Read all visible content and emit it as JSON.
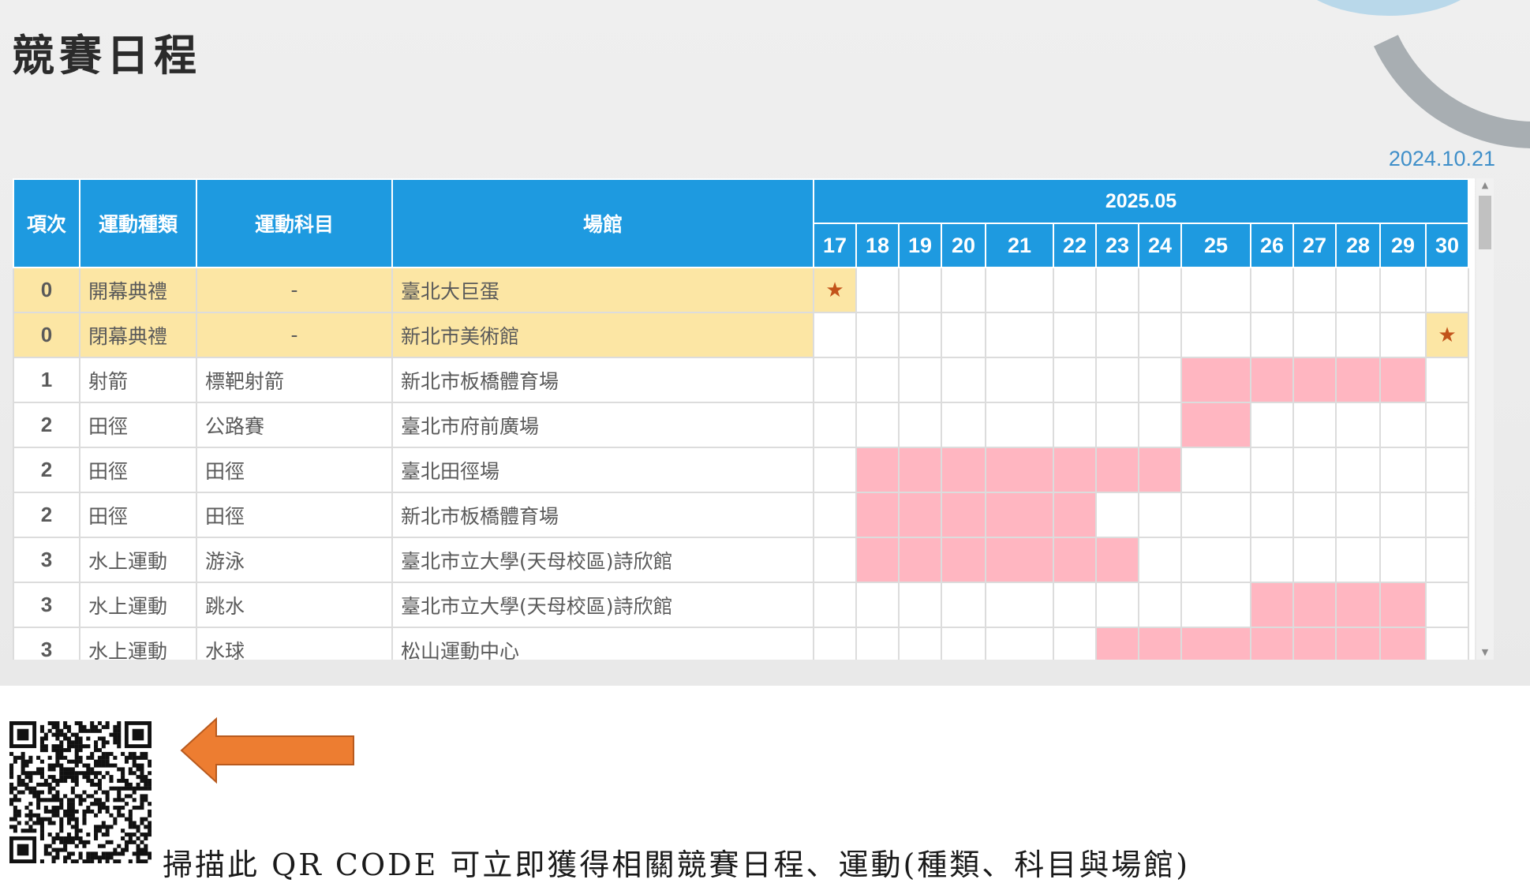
{
  "page_title": "競賽日程",
  "update_date": "2024.10.21",
  "table": {
    "headers": {
      "index": "項次",
      "sport": "運動種類",
      "event": "運動科目",
      "venue": "場館",
      "month": "2025.05"
    },
    "days": [
      "17",
      "18",
      "19",
      "20",
      "21",
      "22",
      "23",
      "24",
      "25",
      "26",
      "27",
      "28",
      "29",
      "30"
    ],
    "marker_symbol": "★",
    "rows": [
      {
        "index": "0",
        "sport": "開幕典禮",
        "event": "-",
        "venue": "臺北大巨蛋",
        "ceremony": true,
        "active_days": [],
        "star_days": [
          "17"
        ]
      },
      {
        "index": "0",
        "sport": "閉幕典禮",
        "event": "-",
        "venue": "新北市美術館",
        "ceremony": true,
        "active_days": [],
        "star_days": [
          "30"
        ]
      },
      {
        "index": "1",
        "sport": "射箭",
        "event": "標靶射箭",
        "venue": "新北市板橋體育場",
        "ceremony": false,
        "active_days": [
          "25",
          "26",
          "27",
          "28",
          "29"
        ],
        "star_days": []
      },
      {
        "index": "2",
        "sport": "田徑",
        "event": "公路賽",
        "venue": "臺北市府前廣場",
        "ceremony": false,
        "active_days": [
          "25"
        ],
        "star_days": []
      },
      {
        "index": "2",
        "sport": "田徑",
        "event": "田徑",
        "venue": "臺北田徑場",
        "ceremony": false,
        "active_days": [
          "18",
          "19",
          "20",
          "21",
          "22",
          "23",
          "24"
        ],
        "star_days": []
      },
      {
        "index": "2",
        "sport": "田徑",
        "event": "田徑",
        "venue": "新北市板橋體育場",
        "ceremony": false,
        "active_days": [
          "18",
          "19",
          "20",
          "21",
          "22"
        ],
        "star_days": []
      },
      {
        "index": "3",
        "sport": "水上運動",
        "event": "游泳",
        "venue": "臺北市立大學(天母校區)詩欣館",
        "ceremony": false,
        "active_days": [
          "18",
          "19",
          "20",
          "21",
          "22",
          "23"
        ],
        "star_days": []
      },
      {
        "index": "3",
        "sport": "水上運動",
        "event": "跳水",
        "venue": "臺北市立大學(天母校區)詩欣館",
        "ceremony": false,
        "active_days": [
          "26",
          "27",
          "28",
          "29"
        ],
        "star_days": []
      },
      {
        "index": "3",
        "sport": "水上運動",
        "event": "水球",
        "venue": "松山運動中心",
        "ceremony": false,
        "active_days": [
          "23",
          "24",
          "25",
          "26",
          "27",
          "28",
          "29"
        ],
        "star_days": []
      }
    ]
  },
  "colors": {
    "header_blue": "#1e9ae0",
    "ceremony_yellow": "#fce6a4",
    "active_pink": "#ffb6c1",
    "star_orange": "#c2531a",
    "arrow_orange": "#ed7d31",
    "date_blue": "#3f8fc9"
  },
  "qr_caption": "掃描此 QR CODE 可立即獲得相關競賽日程、運動(種類、科目與場館)"
}
